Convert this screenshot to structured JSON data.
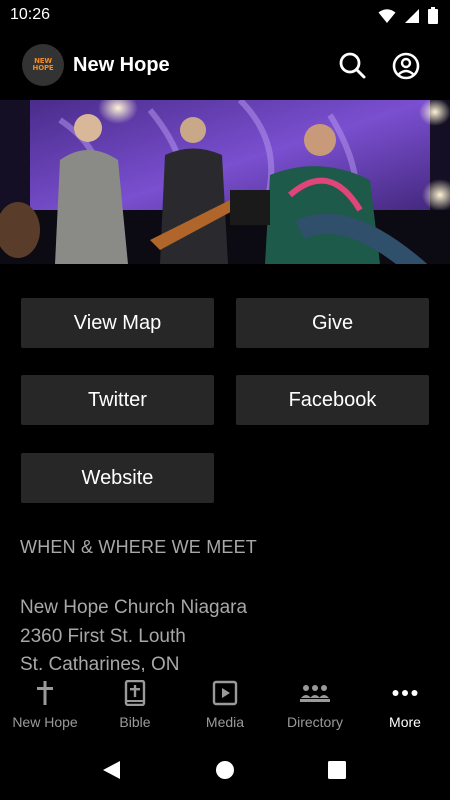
{
  "status": {
    "time": "10:26"
  },
  "app": {
    "title": "New Hope",
    "logo_line1": "NEW",
    "logo_line2": "HOPE"
  },
  "buttons": {
    "view_map": "View Map",
    "give": "Give",
    "twitter": "Twitter",
    "facebook": "Facebook",
    "website": "Website"
  },
  "meeting": {
    "title": "WHEN & WHERE WE MEET",
    "address_lines": [
      "New Hope Church Niagara",
      "2360 First St. Louth",
      "St. Catharines, ON"
    ]
  },
  "nav": {
    "items": [
      {
        "label": "New Hope",
        "icon": "cross-icon"
      },
      {
        "label": "Bible",
        "icon": "bible-icon"
      },
      {
        "label": "Media",
        "icon": "media-icon"
      },
      {
        "label": "Directory",
        "icon": "directory-icon"
      },
      {
        "label": "More",
        "icon": "more-icon"
      }
    ],
    "active": "More"
  },
  "colors": {
    "background": "#000000",
    "button": "#272727",
    "muted_text": "#a8a8a8",
    "logo_accent": "#f08a24"
  }
}
